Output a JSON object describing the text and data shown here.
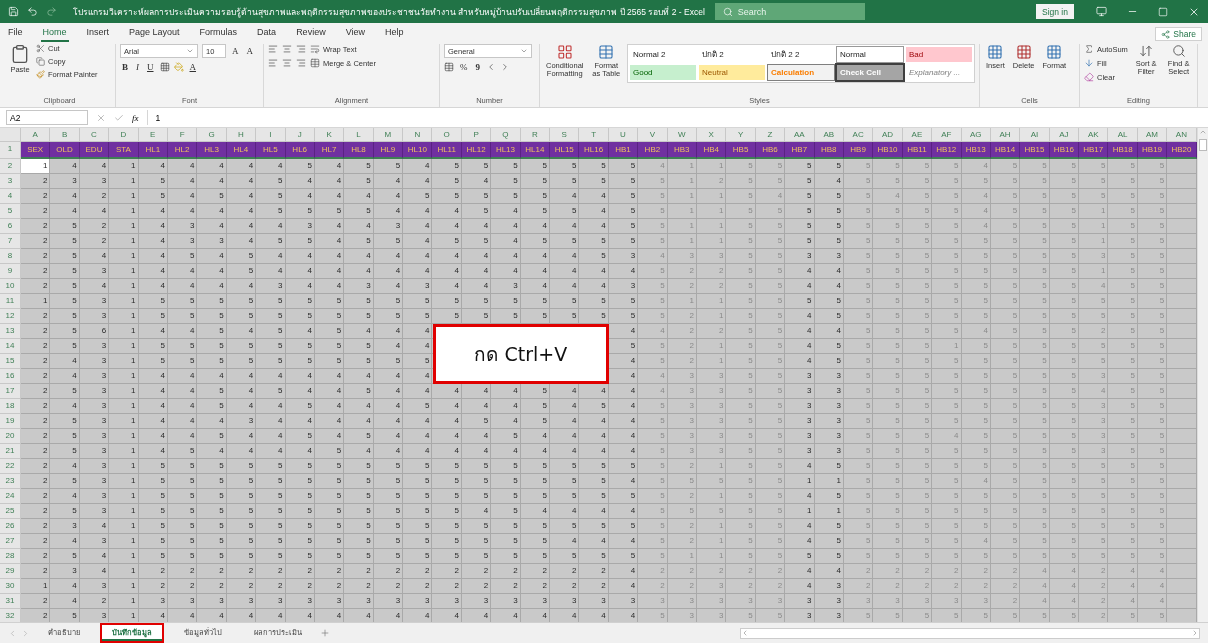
{
  "window": {
    "title": "โปรแกรมวิเคราะห์ผลการประเมินความรอบรู้ด้านสุขภาพและพฤติกรรมสุขภาพของประชาชนวัยทำงาน สำหรับหมู่บ้านปรับเปลี่ยนพฤติกรรมสุขภาพ ปี 2565 รอบที่ 2  -  Excel",
    "search": {
      "placeholder": "Search"
    },
    "sign_in": "Sign in"
  },
  "menu": {
    "tabs": [
      {
        "label": "File",
        "selected": false
      },
      {
        "label": "Home",
        "selected": true
      },
      {
        "label": "Insert",
        "selected": false
      },
      {
        "label": "Page Layout",
        "selected": false
      },
      {
        "label": "Formulas",
        "selected": false
      },
      {
        "label": "Data",
        "selected": false
      },
      {
        "label": "Review",
        "selected": false
      },
      {
        "label": "View",
        "selected": false
      },
      {
        "label": "Help",
        "selected": false
      }
    ],
    "share": "Share"
  },
  "ribbon": {
    "clipboard": {
      "label": "Clipboard",
      "paste": "Paste",
      "cut": "Cut",
      "copy": "Copy",
      "format_painter": "Format Painter"
    },
    "font": {
      "label": "Font",
      "name": "Arial",
      "size": "10",
      "grow": "A",
      "shrink": "A",
      "bold": "B",
      "italic": "I",
      "underline": "U",
      "font_color": "A"
    },
    "alignment": {
      "label": "Alignment",
      "wrap": "Wrap Text",
      "merge": "Merge & Center"
    },
    "number": {
      "label": "Number",
      "format": "General",
      "percent": "%",
      "comma": "9"
    },
    "styles": {
      "label": "Styles",
      "conditional": "Conditional Formatting",
      "format_table": "Format as Table",
      "cells": [
        {
          "label": "Normal 2",
          "kind": "plain"
        },
        {
          "label": "ปกติ 2",
          "kind": "plain"
        },
        {
          "label": "ปกติ 2 2",
          "kind": "plain"
        },
        {
          "label": "Normal",
          "kind": "normal"
        },
        {
          "label": "Bad",
          "kind": "bad"
        },
        {
          "label": "Good",
          "kind": "good"
        },
        {
          "label": "Neutral",
          "kind": "neutral"
        },
        {
          "label": "Calculation",
          "kind": "calculation"
        },
        {
          "label": "Check Cell",
          "kind": "check"
        },
        {
          "label": "Explanatory ...",
          "kind": "explanatory"
        }
      ]
    },
    "cells": {
      "label": "Cells",
      "insert": "Insert",
      "delete": "Delete",
      "format": "Format"
    },
    "editing": {
      "label": "Editing",
      "autosum": "AutoSum",
      "fill": "Fill",
      "clear": "Clear",
      "sort": "Sort & Filter",
      "find": "Find & Select"
    }
  },
  "formula_bar": {
    "name_box": "A2",
    "fx": "fx",
    "value": "1"
  },
  "sheet": {
    "header_row": {
      "number": "1"
    },
    "columns": [
      {
        "letter": "A",
        "header": "SEX",
        "faded": false
      },
      {
        "letter": "B",
        "header": "OLD",
        "faded": false
      },
      {
        "letter": "C",
        "header": "EDU",
        "faded": false
      },
      {
        "letter": "D",
        "header": "STA",
        "faded": false
      },
      {
        "letter": "E",
        "header": "HL1",
        "faded": false
      },
      {
        "letter": "F",
        "header": "HL2",
        "faded": false
      },
      {
        "letter": "G",
        "header": "HL3",
        "faded": false
      },
      {
        "letter": "H",
        "header": "HL4",
        "faded": false
      },
      {
        "letter": "I",
        "header": "HL5",
        "faded": false
      },
      {
        "letter": "J",
        "header": "HL6",
        "faded": false
      },
      {
        "letter": "K",
        "header": "HL7",
        "faded": false
      },
      {
        "letter": "L",
        "header": "HL8",
        "faded": false
      },
      {
        "letter": "M",
        "header": "HL9",
        "faded": false
      },
      {
        "letter": "N",
        "header": "HL10",
        "faded": false
      },
      {
        "letter": "O",
        "header": "HL11",
        "faded": false
      },
      {
        "letter": "P",
        "header": "HL12",
        "faded": false
      },
      {
        "letter": "Q",
        "header": "HL13",
        "faded": false
      },
      {
        "letter": "R",
        "header": "HL14",
        "faded": false
      },
      {
        "letter": "S",
        "header": "HL15",
        "faded": false
      },
      {
        "letter": "T",
        "header": "HL16",
        "faded": false
      },
      {
        "letter": "U",
        "header": "HB1",
        "faded": false
      },
      {
        "letter": "V",
        "header": "HB2",
        "faded": true
      },
      {
        "letter": "W",
        "header": "HB3",
        "faded": true
      },
      {
        "letter": "X",
        "header": "HB4",
        "faded": true
      },
      {
        "letter": "Y",
        "header": "HB5",
        "faded": true
      },
      {
        "letter": "Z",
        "header": "HB6",
        "faded": true
      },
      {
        "letter": "AA",
        "header": "HB7",
        "faded": false
      },
      {
        "letter": "AB",
        "header": "HB8",
        "faded": false
      },
      {
        "letter": "AC",
        "header": "HB9",
        "faded": true
      },
      {
        "letter": "AD",
        "header": "HB10",
        "faded": true
      },
      {
        "letter": "AE",
        "header": "HB11",
        "faded": true
      },
      {
        "letter": "AF",
        "header": "HB12",
        "faded": true
      },
      {
        "letter": "AG",
        "header": "HB13",
        "faded": true
      },
      {
        "letter": "AH",
        "header": "HB14",
        "faded": true
      },
      {
        "letter": "AI",
        "header": "HB15",
        "faded": true
      },
      {
        "letter": "AJ",
        "header": "HB16",
        "faded": true
      },
      {
        "letter": "AK",
        "header": "HB17",
        "faded": true
      },
      {
        "letter": "AL",
        "header": "HB18",
        "faded": true
      },
      {
        "letter": "AM",
        "header": "HB19",
        "faded": true
      },
      {
        "letter": "AN",
        "header": "HB20"
      }
    ],
    "rows": [
      {
        "number": "2",
        "cells": [
          "1",
          "4",
          "4",
          "1",
          "4",
          "4",
          "4",
          "4",
          "4",
          "5",
          "4",
          "5",
          "5",
          "4",
          "5",
          "5",
          "5",
          "5",
          "5",
          "5",
          "5",
          "4",
          "1",
          "1",
          "5",
          "5",
          "5",
          "5",
          "5",
          "5",
          "5",
          "5",
          "4",
          "5",
          "5",
          "5",
          "5",
          "5",
          "5"
        ]
      },
      {
        "number": "3",
        "cells": [
          "2",
          "3",
          "3",
          "1",
          "5",
          "4",
          "4",
          "4",
          "5",
          "4",
          "4",
          "5",
          "4",
          "4",
          "5",
          "4",
          "5",
          "5",
          "5",
          "5",
          "5",
          "5",
          "1",
          "2",
          "5",
          "5",
          "5",
          "4",
          "5",
          "5",
          "5",
          "5",
          "5",
          "5",
          "5",
          "5",
          "5",
          "5",
          "5"
        ]
      },
      {
        "number": "4",
        "cells": [
          "2",
          "4",
          "2",
          "1",
          "5",
          "4",
          "5",
          "4",
          "5",
          "4",
          "4",
          "4",
          "4",
          "5",
          "5",
          "5",
          "5",
          "5",
          "4",
          "4",
          "5",
          "5",
          "1",
          "1",
          "5",
          "4",
          "5",
          "5",
          "5",
          "4",
          "5",
          "5",
          "4",
          "5",
          "5",
          "5",
          "5",
          "5",
          "5"
        ]
      },
      {
        "number": "5",
        "cells": [
          "2",
          "4",
          "4",
          "1",
          "4",
          "4",
          "4",
          "4",
          "5",
          "5",
          "5",
          "5",
          "4",
          "4",
          "4",
          "5",
          "4",
          "5",
          "5",
          "4",
          "5",
          "5",
          "1",
          "1",
          "5",
          "5",
          "5",
          "5",
          "5",
          "5",
          "5",
          "5",
          "4",
          "5",
          "5",
          "5",
          "1",
          "5",
          "5"
        ]
      },
      {
        "number": "6",
        "cells": [
          "2",
          "5",
          "2",
          "1",
          "4",
          "3",
          "4",
          "4",
          "4",
          "3",
          "4",
          "4",
          "3",
          "4",
          "4",
          "4",
          "4",
          "4",
          "4",
          "4",
          "5",
          "5",
          "1",
          "1",
          "5",
          "5",
          "5",
          "5",
          "5",
          "5",
          "5",
          "5",
          "4",
          "5",
          "5",
          "5",
          "1",
          "5",
          "5"
        ]
      },
      {
        "number": "7",
        "cells": [
          "2",
          "5",
          "2",
          "1",
          "4",
          "3",
          "3",
          "4",
          "5",
          "5",
          "4",
          "5",
          "5",
          "4",
          "5",
          "5",
          "4",
          "5",
          "5",
          "5",
          "5",
          "5",
          "1",
          "1",
          "5",
          "5",
          "5",
          "5",
          "5",
          "5",
          "5",
          "5",
          "5",
          "5",
          "5",
          "5",
          "1",
          "5",
          "5"
        ]
      },
      {
        "number": "8",
        "cells": [
          "2",
          "5",
          "4",
          "1",
          "4",
          "5",
          "4",
          "5",
          "4",
          "4",
          "4",
          "4",
          "4",
          "4",
          "4",
          "4",
          "4",
          "4",
          "4",
          "5",
          "3",
          "4",
          "3",
          "3",
          "5",
          "5",
          "3",
          "3",
          "5",
          "5",
          "5",
          "5",
          "5",
          "5",
          "5",
          "5",
          "3",
          "5",
          "5"
        ]
      },
      {
        "number": "9",
        "cells": [
          "2",
          "5",
          "3",
          "1",
          "4",
          "4",
          "4",
          "5",
          "4",
          "4",
          "4",
          "4",
          "4",
          "4",
          "4",
          "4",
          "4",
          "4",
          "4",
          "4",
          "4",
          "5",
          "2",
          "2",
          "5",
          "5",
          "4",
          "4",
          "5",
          "5",
          "5",
          "5",
          "5",
          "5",
          "5",
          "5",
          "1",
          "5",
          "5"
        ]
      },
      {
        "number": "10",
        "cells": [
          "2",
          "5",
          "4",
          "1",
          "4",
          "4",
          "4",
          "4",
          "3",
          "4",
          "4",
          "3",
          "4",
          "3",
          "4",
          "4",
          "3",
          "4",
          "4",
          "4",
          "3",
          "5",
          "2",
          "2",
          "5",
          "5",
          "4",
          "4",
          "5",
          "5",
          "5",
          "5",
          "5",
          "5",
          "5",
          "5",
          "4",
          "5",
          "5"
        ]
      },
      {
        "number": "11",
        "cells": [
          "1",
          "5",
          "3",
          "1",
          "5",
          "5",
          "5",
          "5",
          "5",
          "5",
          "5",
          "5",
          "5",
          "5",
          "5",
          "5",
          "5",
          "5",
          "5",
          "5",
          "5",
          "5",
          "1",
          "1",
          "5",
          "5",
          "5",
          "5",
          "5",
          "5",
          "5",
          "5",
          "5",
          "5",
          "5",
          "5",
          "5",
          "5",
          "5"
        ]
      },
      {
        "number": "12",
        "cells": [
          "2",
          "5",
          "3",
          "1",
          "5",
          "5",
          "5",
          "5",
          "5",
          "5",
          "5",
          "5",
          "5",
          "5",
          "5",
          "5",
          "5",
          "5",
          "5",
          "5",
          "5",
          "5",
          "2",
          "1",
          "5",
          "5",
          "4",
          "5",
          "5",
          "5",
          "5",
          "5",
          "5",
          "5",
          "5",
          "5",
          "5",
          "5",
          "5"
        ]
      },
      {
        "number": "13",
        "cells": [
          "2",
          "5",
          "6",
          "1",
          "4",
          "4",
          "5",
          "4",
          "5",
          "4",
          "5",
          "4",
          "4",
          "4",
          null,
          null,
          null,
          null,
          null,
          null,
          "4",
          "4",
          "2",
          "2",
          "5",
          "5",
          "4",
          "4",
          "5",
          "5",
          "5",
          "5",
          "4",
          "5",
          "5",
          "5",
          "2",
          "5",
          "5"
        ]
      },
      {
        "number": "14",
        "cells": [
          "2",
          "5",
          "3",
          "1",
          "5",
          "5",
          "5",
          "5",
          "5",
          "5",
          "5",
          "5",
          "4",
          "4",
          null,
          null,
          null,
          null,
          null,
          null,
          "5",
          "5",
          "2",
          "1",
          "5",
          "5",
          "4",
          "5",
          "5",
          "5",
          "5",
          "1",
          "5",
          "5",
          "5",
          "5",
          "5",
          "5",
          "5"
        ]
      },
      {
        "number": "15",
        "cells": [
          "2",
          "4",
          "3",
          "1",
          "5",
          "5",
          "5",
          "5",
          "5",
          "5",
          "5",
          "5",
          "5",
          "5",
          null,
          null,
          null,
          null,
          null,
          null,
          "4",
          "5",
          "2",
          "1",
          "5",
          "5",
          "4",
          "5",
          "5",
          "5",
          "5",
          "5",
          "5",
          "5",
          "5",
          "5",
          "5",
          "5",
          "5"
        ]
      },
      {
        "number": "16",
        "cells": [
          "2",
          "4",
          "3",
          "1",
          "4",
          "4",
          "4",
          "4",
          "4",
          "4",
          "4",
          "4",
          "4",
          "4",
          null,
          null,
          null,
          null,
          null,
          null,
          "4",
          "4",
          "3",
          "3",
          "5",
          "5",
          "3",
          "3",
          "5",
          "5",
          "5",
          "5",
          "5",
          "5",
          "5",
          "5",
          "3",
          "5",
          "5"
        ]
      },
      {
        "number": "17",
        "cells": [
          "2",
          "5",
          "3",
          "1",
          "4",
          "4",
          "5",
          "4",
          "5",
          "4",
          "4",
          "5",
          "4",
          "4",
          "4",
          "4",
          "4",
          "5",
          "4",
          "4",
          "4",
          "4",
          "3",
          "3",
          "5",
          "5",
          "3",
          "3",
          "5",
          "5",
          "5",
          "5",
          "5",
          "5",
          "5",
          "5",
          "4",
          "5",
          "5"
        ]
      },
      {
        "number": "18",
        "cells": [
          "2",
          "4",
          "3",
          "1",
          "4",
          "4",
          "5",
          "4",
          "4",
          "5",
          "4",
          "4",
          "4",
          "5",
          "4",
          "4",
          "4",
          "5",
          "4",
          "5",
          "4",
          "5",
          "3",
          "3",
          "5",
          "5",
          "3",
          "3",
          "5",
          "5",
          "5",
          "5",
          "5",
          "5",
          "5",
          "5",
          "3",
          "5",
          "5"
        ]
      },
      {
        "number": "19",
        "cells": [
          "2",
          "5",
          "3",
          "1",
          "4",
          "4",
          "4",
          "3",
          "4",
          "4",
          "4",
          "4",
          "4",
          "4",
          "4",
          "5",
          "4",
          "5",
          "4",
          "4",
          "4",
          "5",
          "3",
          "3",
          "5",
          "5",
          "3",
          "3",
          "5",
          "5",
          "5",
          "5",
          "5",
          "5",
          "5",
          "5",
          "3",
          "5",
          "5"
        ]
      },
      {
        "number": "20",
        "cells": [
          "2",
          "5",
          "3",
          "1",
          "4",
          "4",
          "5",
          "4",
          "4",
          "5",
          "4",
          "5",
          "4",
          "4",
          "4",
          "4",
          "5",
          "4",
          "4",
          "4",
          "4",
          "5",
          "3",
          "3",
          "5",
          "5",
          "3",
          "3",
          "5",
          "5",
          "5",
          "4",
          "5",
          "5",
          "5",
          "5",
          "3",
          "5",
          "5"
        ]
      },
      {
        "number": "21",
        "cells": [
          "2",
          "5",
          "3",
          "1",
          "4",
          "5",
          "4",
          "4",
          "4",
          "4",
          "5",
          "4",
          "4",
          "4",
          "4",
          "4",
          "4",
          "4",
          "4",
          "4",
          "4",
          "5",
          "3",
          "3",
          "5",
          "5",
          "3",
          "3",
          "5",
          "5",
          "5",
          "5",
          "5",
          "5",
          "5",
          "5",
          "3",
          "5",
          "5"
        ]
      },
      {
        "number": "22",
        "cells": [
          "2",
          "4",
          "3",
          "1",
          "5",
          "5",
          "5",
          "5",
          "5",
          "5",
          "5",
          "5",
          "5",
          "5",
          "5",
          "5",
          "5",
          "5",
          "5",
          "5",
          "5",
          "5",
          "2",
          "1",
          "5",
          "5",
          "4",
          "5",
          "5",
          "5",
          "5",
          "5",
          "5",
          "5",
          "5",
          "5",
          "5",
          "5",
          "5"
        ]
      },
      {
        "number": "23",
        "cells": [
          "2",
          "5",
          "3",
          "1",
          "5",
          "5",
          "5",
          "5",
          "5",
          "5",
          "5",
          "5",
          "5",
          "5",
          "5",
          "5",
          "5",
          "5",
          "5",
          "5",
          "4",
          "5",
          "5",
          "5",
          "5",
          "5",
          "1",
          "1",
          "5",
          "5",
          "5",
          "5",
          "4",
          "5",
          "5",
          "5",
          "5",
          "5",
          "5"
        ]
      },
      {
        "number": "24",
        "cells": [
          "2",
          "4",
          "3",
          "1",
          "5",
          "5",
          "5",
          "5",
          "5",
          "5",
          "5",
          "5",
          "5",
          "5",
          "5",
          "5",
          "5",
          "5",
          "5",
          "5",
          "5",
          "5",
          "2",
          "1",
          "5",
          "5",
          "4",
          "5",
          "5",
          "5",
          "5",
          "5",
          "5",
          "5",
          "5",
          "5",
          "5",
          "5",
          "5"
        ]
      },
      {
        "number": "25",
        "cells": [
          "2",
          "5",
          "3",
          "1",
          "5",
          "5",
          "5",
          "5",
          "5",
          "5",
          "5",
          "5",
          "5",
          "5",
          "5",
          "4",
          "5",
          "4",
          "4",
          "4",
          "4",
          "5",
          "5",
          "5",
          "5",
          "5",
          "1",
          "1",
          "5",
          "5",
          "5",
          "5",
          "5",
          "5",
          "5",
          "5",
          "5",
          "5",
          "5"
        ]
      },
      {
        "number": "26",
        "cells": [
          "2",
          "3",
          "4",
          "1",
          "5",
          "5",
          "5",
          "5",
          "5",
          "5",
          "5",
          "5",
          "5",
          "5",
          "5",
          "5",
          "5",
          "5",
          "5",
          "5",
          "5",
          "5",
          "2",
          "1",
          "5",
          "5",
          "4",
          "5",
          "5",
          "5",
          "5",
          "5",
          "5",
          "5",
          "5",
          "5",
          "5",
          "5",
          "5"
        ]
      },
      {
        "number": "27",
        "cells": [
          "2",
          "4",
          "3",
          "1",
          "5",
          "5",
          "5",
          "5",
          "5",
          "5",
          "5",
          "5",
          "5",
          "5",
          "5",
          "5",
          "5",
          "5",
          "4",
          "4",
          "4",
          "5",
          "2",
          "1",
          "5",
          "5",
          "4",
          "5",
          "5",
          "5",
          "5",
          "5",
          "4",
          "5",
          "5",
          "5",
          "5",
          "5",
          "5"
        ]
      },
      {
        "number": "28",
        "cells": [
          "2",
          "5",
          "4",
          "1",
          "5",
          "5",
          "5",
          "5",
          "5",
          "5",
          "5",
          "5",
          "5",
          "5",
          "5",
          "5",
          "5",
          "5",
          "5",
          "5",
          "5",
          "5",
          "1",
          "1",
          "5",
          "5",
          "5",
          "5",
          "5",
          "5",
          "5",
          "5",
          "5",
          "5",
          "5",
          "5",
          "5",
          "5",
          "5"
        ]
      },
      {
        "number": "29",
        "cells": [
          "2",
          "3",
          "4",
          "1",
          "2",
          "2",
          "2",
          "2",
          "2",
          "2",
          "2",
          "2",
          "2",
          "2",
          "2",
          "2",
          "2",
          "2",
          "2",
          "2",
          "4",
          "2",
          "2",
          "2",
          "2",
          "2",
          "4",
          "4",
          "2",
          "2",
          "2",
          "2",
          "2",
          "2",
          "4",
          "4",
          "2",
          "4",
          "4"
        ]
      },
      {
        "number": "30",
        "cells": [
          "1",
          "4",
          "3",
          "1",
          "2",
          "2",
          "2",
          "2",
          "2",
          "2",
          "2",
          "2",
          "2",
          "2",
          "2",
          "2",
          "2",
          "2",
          "2",
          "2",
          "4",
          "2",
          "2",
          "3",
          "2",
          "2",
          "4",
          "3",
          "2",
          "2",
          "2",
          "2",
          "2",
          "2",
          "4",
          "4",
          "2",
          "4",
          "4"
        ]
      },
      {
        "number": "31",
        "cells": [
          "2",
          "4",
          "2",
          "1",
          "3",
          "3",
          "3",
          "3",
          "3",
          "3",
          "3",
          "3",
          "3",
          "3",
          "3",
          "3",
          "3",
          "3",
          "3",
          "3",
          "3",
          "3",
          "3",
          "3",
          "3",
          "3",
          "3",
          "3",
          "3",
          "3",
          "3",
          "3",
          "3",
          "2",
          "4",
          "4",
          "2",
          "4",
          "4"
        ]
      },
      {
        "number": "32",
        "cells": [
          "2",
          "5",
          "3",
          "1",
          "4",
          "4",
          "4",
          "4",
          "4",
          "4",
          "4",
          "4",
          "4",
          "4",
          "4",
          "4",
          "4",
          "4",
          "4",
          "4",
          "4",
          "5",
          "3",
          "3",
          "5",
          "5",
          "3",
          "3",
          "5",
          "5",
          "5",
          "5",
          "5",
          "5",
          "5",
          "5",
          "2",
          "5",
          "5"
        ]
      }
    ],
    "callout": {
      "text": "กด Ctrl+V"
    }
  },
  "sheet_tabs": [
    {
      "label": "คำอธิบาย",
      "selected": false,
      "marked": false
    },
    {
      "label": "บันทึกข้อมูล",
      "selected": true,
      "marked": true
    },
    {
      "label": "ข้อมูลทั่วไป",
      "selected": false,
      "marked": false
    },
    {
      "label": "ผลการประเมิน",
      "selected": false,
      "marked": false
    }
  ]
}
